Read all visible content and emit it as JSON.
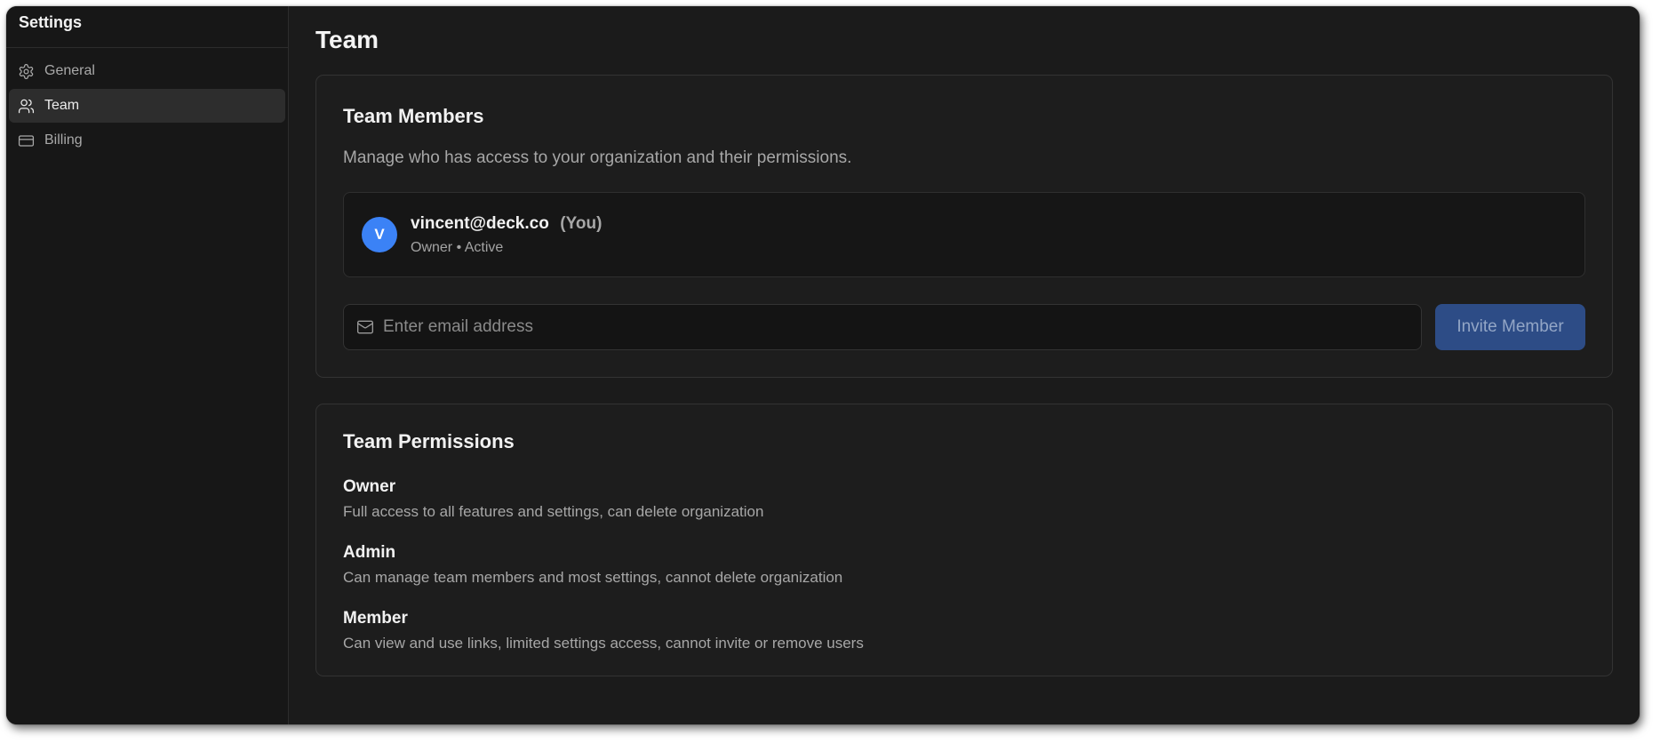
{
  "sidebar": {
    "title": "Settings",
    "items": [
      {
        "label": "General",
        "icon": "gear-icon"
      },
      {
        "label": "Team",
        "icon": "users-icon",
        "active": true
      },
      {
        "label": "Billing",
        "icon": "credit-card-icon"
      }
    ]
  },
  "main": {
    "title": "Team",
    "members_card": {
      "title": "Team Members",
      "description": "Manage who has access to your organization and their permissions.",
      "member": {
        "avatar_initial": "V",
        "email": "vincent@deck.co",
        "you_label": "(You)",
        "meta": "Owner • Active"
      },
      "invite": {
        "placeholder": "Enter email address",
        "button_label": "Invite Member"
      }
    },
    "permissions_card": {
      "title": "Team Permissions",
      "roles": [
        {
          "name": "Owner",
          "description": "Full access to all features and settings, can delete organization"
        },
        {
          "name": "Admin",
          "description": "Can manage team members and most settings, cannot delete organization"
        },
        {
          "name": "Member",
          "description": "Can view and use links, limited settings access, cannot invite or remove users"
        }
      ]
    }
  },
  "colors": {
    "background": "#1b1b1b",
    "sidebar": "#171717",
    "accent": "#3b82f6",
    "button_disabled": "#2d4c86"
  }
}
